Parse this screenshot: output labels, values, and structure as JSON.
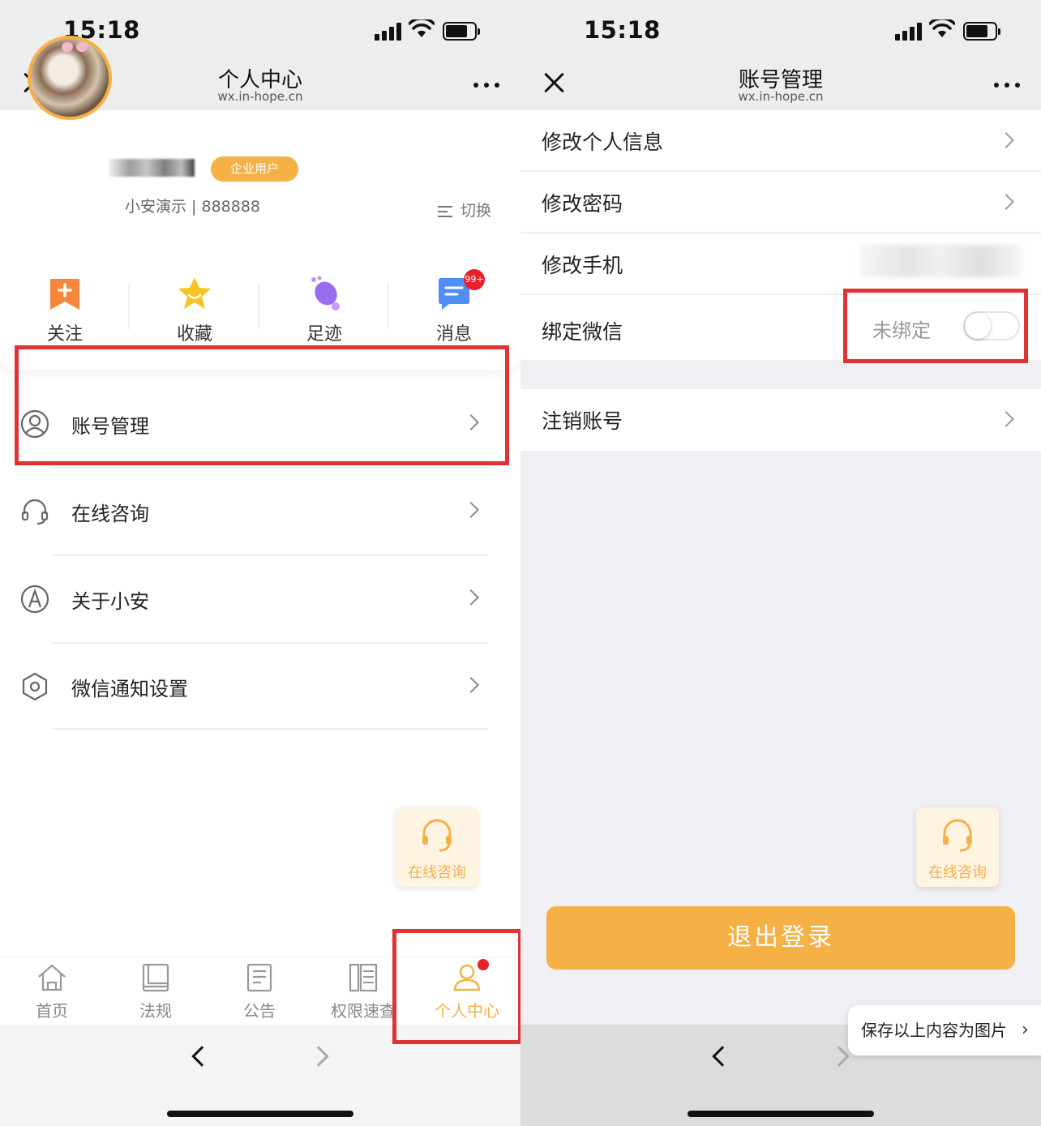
{
  "status": {
    "time": "15:18"
  },
  "left": {
    "nav": {
      "title": "个人中心",
      "url": "wx.in-hope.cn"
    },
    "profile": {
      "badge": "企业用户",
      "org": "小安演示 | 888888",
      "switch_label": "切换"
    },
    "actions": [
      {
        "label": "关注",
        "icon": "bookmark-plus-icon"
      },
      {
        "label": "收藏",
        "icon": "star-icon"
      },
      {
        "label": "足迹",
        "icon": "footprint-icon"
      },
      {
        "label": "消息",
        "icon": "chat-icon",
        "badge": "99+"
      }
    ],
    "menu": [
      {
        "label": "账号管理",
        "icon": "user-circle-icon"
      },
      {
        "label": "在线咨询",
        "icon": "headset-icon"
      },
      {
        "label": "关于小安",
        "icon": "logo-a-icon"
      },
      {
        "label": "微信通知设置",
        "icon": "gear-hex-icon"
      }
    ],
    "float_consult": "在线咨询",
    "tabs": [
      {
        "label": "首页",
        "icon": "home-icon"
      },
      {
        "label": "法规",
        "icon": "book-icon"
      },
      {
        "label": "公告",
        "icon": "document-icon"
      },
      {
        "label": "权限速查",
        "icon": "columns-icon"
      },
      {
        "label": "个人中心",
        "icon": "person-icon",
        "active": true
      }
    ]
  },
  "right": {
    "nav": {
      "title": "账号管理",
      "url": "wx.in-hope.cn"
    },
    "settings": [
      {
        "label": "修改个人信息"
      },
      {
        "label": "修改密码"
      },
      {
        "label": "修改手机"
      },
      {
        "label": "绑定微信",
        "value": "未绑定",
        "toggle": false
      }
    ],
    "cancel_account": "注销账号",
    "float_consult": "在线咨询",
    "logout": "退出登录",
    "save_image": "保存以上内容为图片"
  },
  "colors": {
    "accent": "#f5b145",
    "highlight": "#e03335",
    "badge_red": "#e8202a"
  }
}
